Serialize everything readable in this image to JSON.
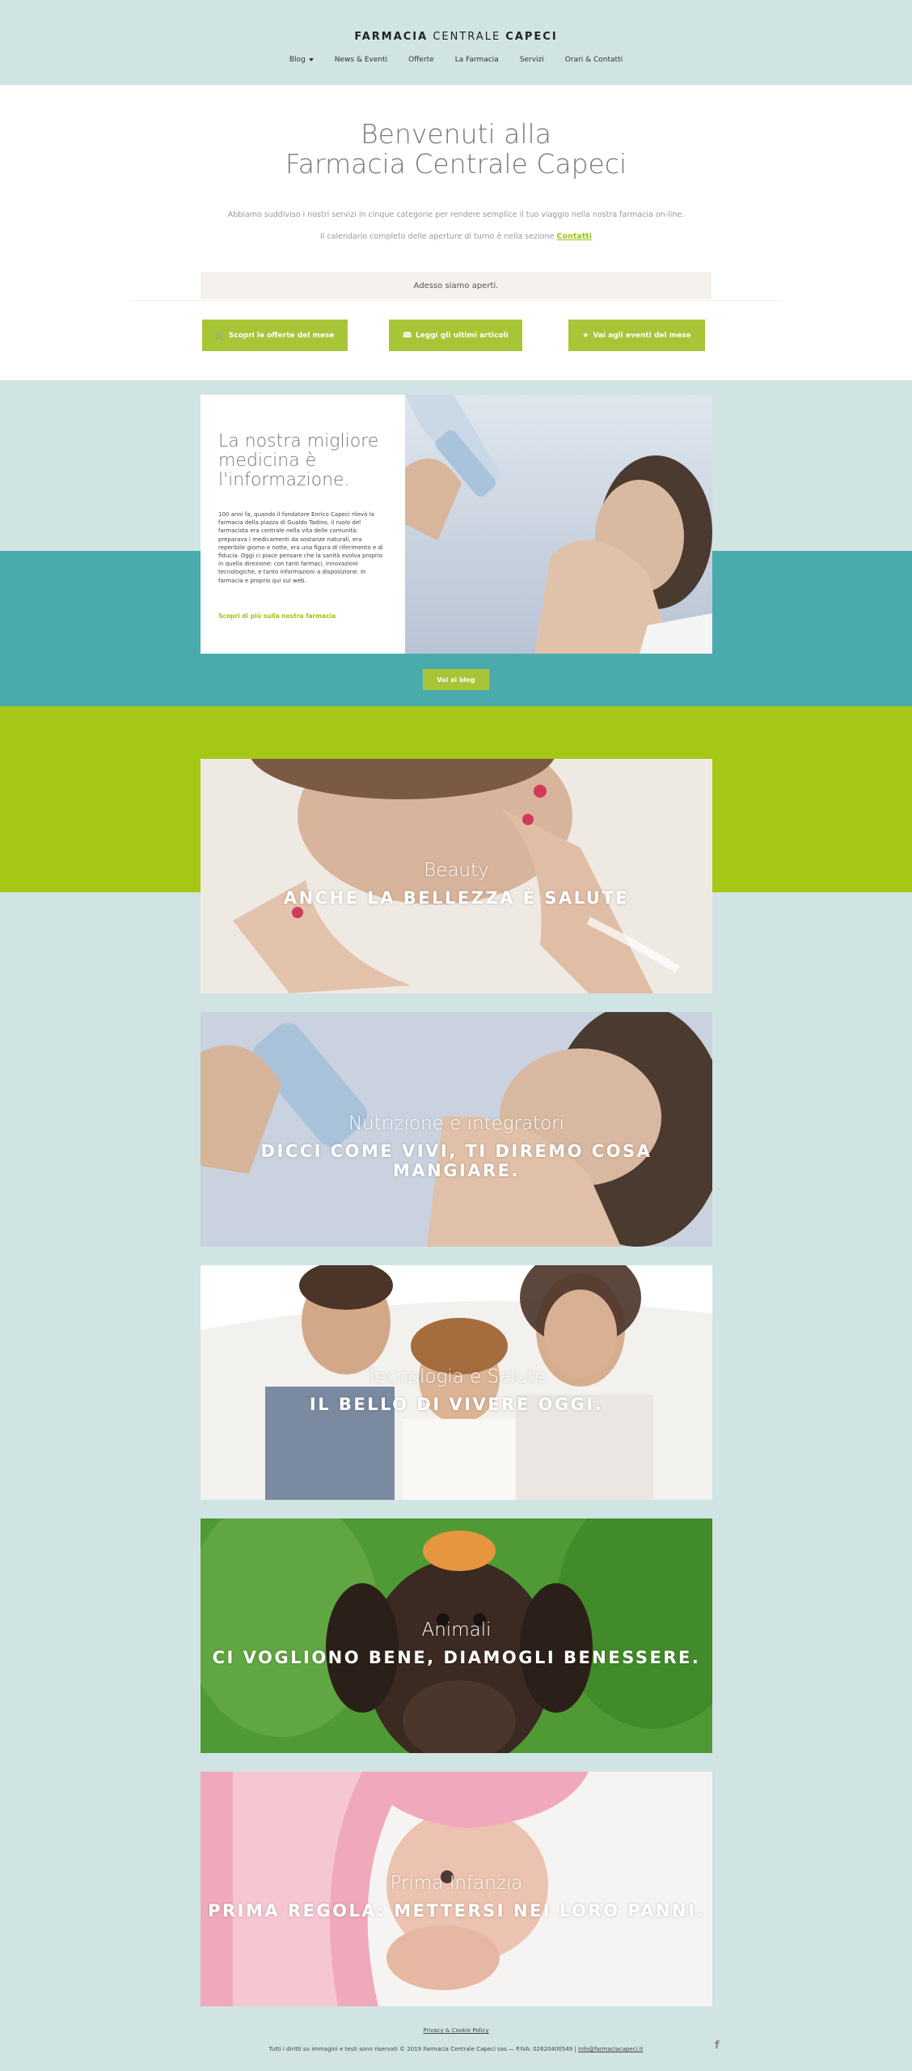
{
  "header": {
    "logo_bold1": "FARMACIA",
    "logo_light": " CENTRALE ",
    "logo_bold2": "CAPECI",
    "nav": [
      {
        "label": "Blog"
      },
      {
        "label": "News & Eventi"
      },
      {
        "label": "Offerte"
      },
      {
        "label": "La Farmacia"
      },
      {
        "label": "Servizi"
      },
      {
        "label": "Orari & Contatti"
      }
    ]
  },
  "welcome": {
    "title_line1": "Benvenuti alla",
    "title_line2": "Farmacia Centrale Capeci",
    "intro": "Abbiamo suddiviso i nostri servizi in cinque categorie per rendere semplice il tuo viaggio nella nostra farmacia on-line.",
    "intro2": "Il calendario completo delle aperture di turno è nella sezione ",
    "contact_link": "Contatti",
    "open_status": "Adesso siamo aperti.",
    "buttons": [
      {
        "label": "Scopri le offerte del mese",
        "icon": "cart-icon",
        "glyph": "🛒"
      },
      {
        "label": "Leggi gli ultimi articoli",
        "icon": "book-icon",
        "glyph": "🕮"
      },
      {
        "label": "Vai agli eventi del mese",
        "icon": "star-icon",
        "glyph": "★"
      }
    ]
  },
  "info": {
    "title": "La nostra migliore medicina è l'informazione.",
    "body": "100 anni fa, quando il fondatore Enrico Capeci rilevò la farmacia della piazza di Gualdo Tadino, il ruolo del farmacista era centrale nella vita delle comunità: preparava i medicamenti da sostanze naturali, era reperibile giorno e notte, era una figura di riferimento e di fiducia. Oggi ci piace pensare che la sanità evolva proprio in quella direzione: con tanti farmaci, innovazioni tecnologiche, e tanto informazioni a disposizione. In farmacia e proprio qui sul web.",
    "link": "Scopri di più sulla nostra farmacia",
    "blog_button": "Vai al blog"
  },
  "categories": [
    {
      "title": "Beauty",
      "subtitle": "ANCHE LA BELLEZZA È SALUTE"
    },
    {
      "title": "Nutrizione e integratori",
      "subtitle": "DICCI COME VIVI, TI DIREMO COSA MANGIARE."
    },
    {
      "title": "Tecnologia e Salute",
      "subtitle": "IL BELLO DI VIVERE OGGI."
    },
    {
      "title": "Animali",
      "subtitle": "CI VOGLIONO BENE, DIAMOGLI BENESSERE."
    },
    {
      "title": "Prima Infanzia",
      "subtitle": "PRIMA REGOLA: METTERSI NEI LORO PANNI."
    }
  ],
  "footer": {
    "privacy": "Privacy & Cookie Policy",
    "copyright": "Tutti i diritti su immagini e testi sono riservati © 2019 Farmacia Centrale Capeci sas — P.IVA: 02620400549 | ",
    "email": "info@farmaciacapeci.it",
    "social_icon": "facebook-icon",
    "social_glyph": "f"
  },
  "colors": {
    "accent_green": "#a7c536",
    "background_teal_light": "#d0e4e4",
    "band_teal": "#4aabad",
    "band_green": "#a5c715"
  }
}
